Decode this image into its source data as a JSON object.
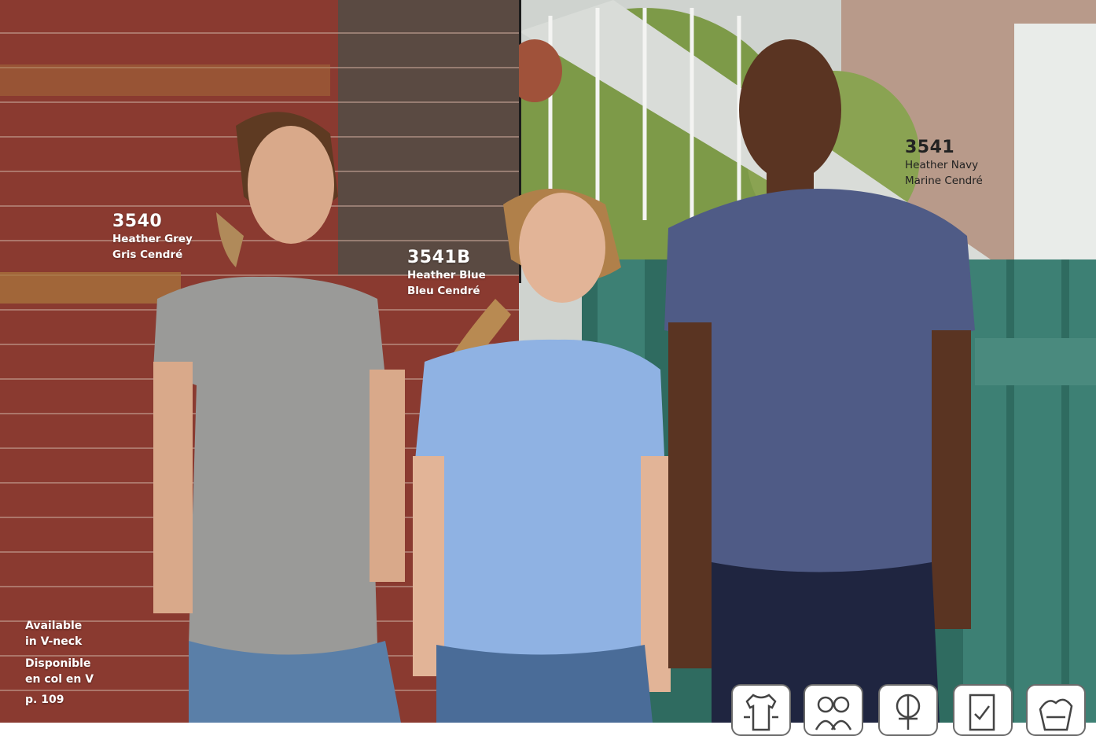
{
  "products": [
    {
      "code": "3540",
      "color_en": "Heather Grey",
      "color_fr": "Gris Cendré"
    },
    {
      "code": "3541B",
      "color_en": "Heather Blue",
      "color_fr": "Bleu Cendré"
    },
    {
      "code": "3541",
      "color_en": "Heather Navy",
      "color_fr": "Marine Cendré"
    }
  ],
  "availability": {
    "en_line1": "Available",
    "en_line2": "in V-neck",
    "fr_line1": "Disponible",
    "fr_line2": "en col en V",
    "page_ref": "p. 109"
  },
  "feature_icons": [
    "tshirt-fit-icon",
    "unisex-group-icon",
    "female-fit-icon",
    "tear-away-label-icon",
    "garment-wash-icon"
  ],
  "colors": {
    "shirt_grey": "#9a9a98",
    "shirt_light_blue": "#8fb2e3",
    "shirt_navy": "#4f5b86",
    "brick": "#8a3a30",
    "fence_green": "#2f6b60"
  }
}
